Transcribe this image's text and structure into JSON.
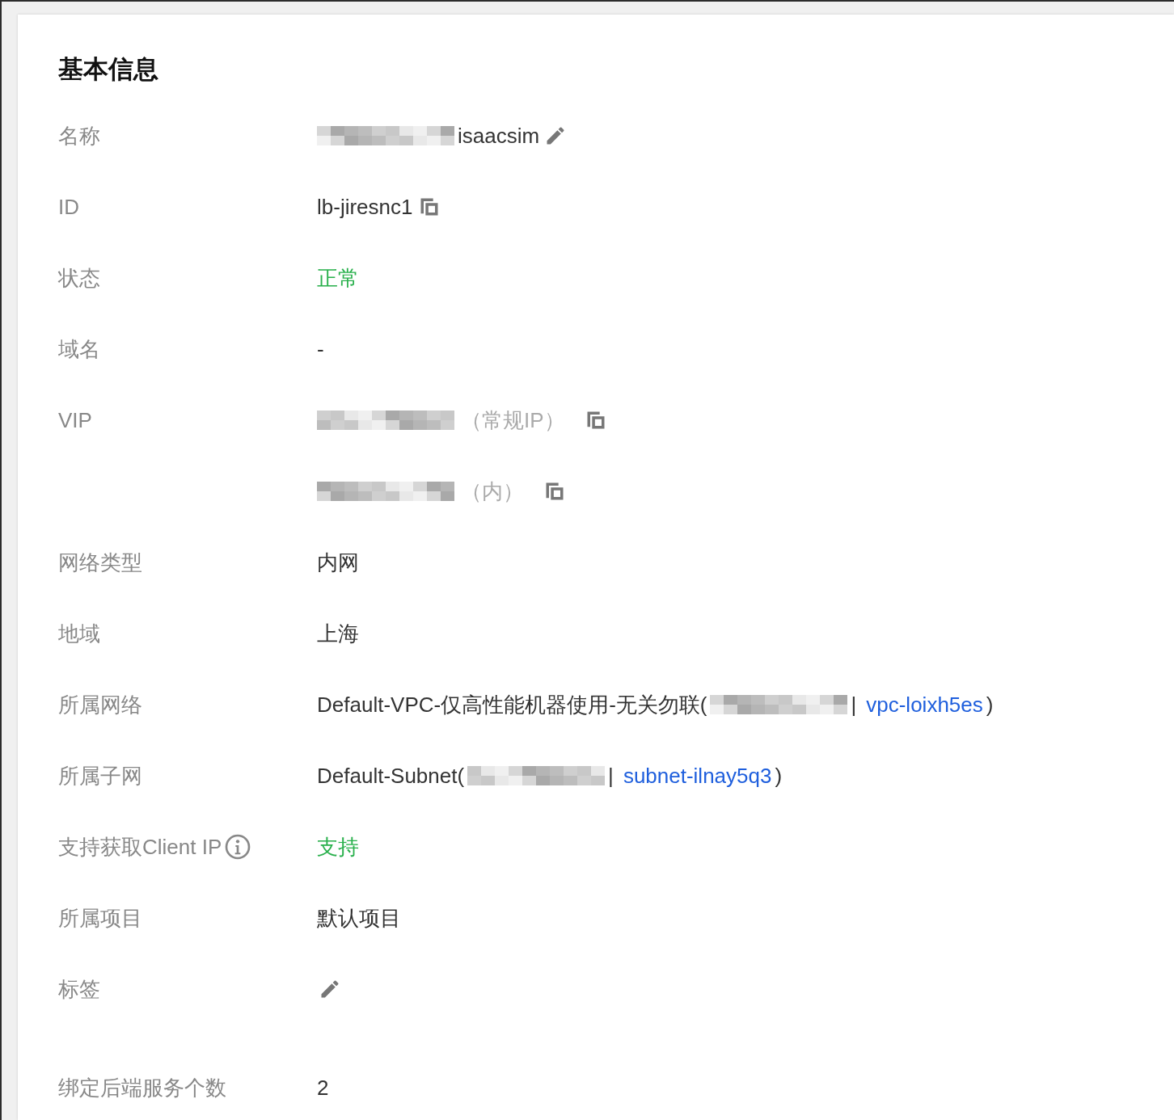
{
  "title": "基本信息",
  "rows": [
    {
      "label": "名称",
      "info": false,
      "lines": [
        [
          {
            "kind": "redacted"
          },
          {
            "kind": "text",
            "text": "isaacsim"
          },
          {
            "kind": "edit"
          }
        ]
      ]
    },
    {
      "label": "ID",
      "info": false,
      "lines": [
        [
          {
            "kind": "text",
            "text": "lb-jiresnc1"
          },
          {
            "kind": "copy"
          }
        ]
      ]
    },
    {
      "label": "状态",
      "info": false,
      "lines": [
        [
          {
            "kind": "success",
            "text": "正常"
          }
        ]
      ]
    },
    {
      "label": "域名",
      "info": false,
      "lines": [
        [
          {
            "kind": "text",
            "text": "-"
          }
        ]
      ]
    },
    {
      "label": "VIP",
      "info": false,
      "lines": [
        [
          {
            "kind": "redacted"
          },
          {
            "kind": "muted",
            "text": "（常规IP）"
          },
          {
            "kind": "copy"
          }
        ],
        [
          {
            "kind": "redacted"
          },
          {
            "kind": "muted",
            "text": "（内）"
          },
          {
            "kind": "copy"
          }
        ]
      ]
    },
    {
      "label": "网络类型",
      "info": false,
      "lines": [
        [
          {
            "kind": "text",
            "text": "内网"
          }
        ]
      ]
    },
    {
      "label": "地域",
      "info": false,
      "lines": [
        [
          {
            "kind": "text",
            "text": "上海"
          }
        ]
      ]
    },
    {
      "label": "所属网络",
      "info": false,
      "lines": [
        [
          {
            "kind": "text",
            "text": "Default-VPC-仅高性能机器使用-无关勿联("
          },
          {
            "kind": "redacted"
          },
          {
            "kind": "text",
            "text": "|"
          },
          {
            "kind": "link",
            "text": "vpc-loixh5es"
          },
          {
            "kind": "text",
            "text": ")"
          }
        ]
      ]
    },
    {
      "label": "所属子网",
      "info": false,
      "lines": [
        [
          {
            "kind": "text",
            "text": "Default-Subnet("
          },
          {
            "kind": "redacted"
          },
          {
            "kind": "text",
            "text": "|"
          },
          {
            "kind": "link",
            "text": "subnet-ilnay5q3"
          },
          {
            "kind": "text",
            "text": ")"
          }
        ]
      ]
    },
    {
      "label": "支持获取Client IP",
      "info": true,
      "lines": [
        [
          {
            "kind": "success",
            "text": "支持"
          }
        ]
      ]
    },
    {
      "label": "所属项目",
      "info": false,
      "lines": [
        [
          {
            "kind": "text",
            "text": "默认项目"
          }
        ]
      ]
    },
    {
      "label": "标签",
      "info": false,
      "lines": [
        [
          {
            "kind": "edit"
          }
        ]
      ]
    },
    {
      "label": "绑定后端服务个数",
      "info": false,
      "lines": [
        [
          {
            "kind": "text",
            "text": "2"
          }
        ]
      ]
    }
  ]
}
